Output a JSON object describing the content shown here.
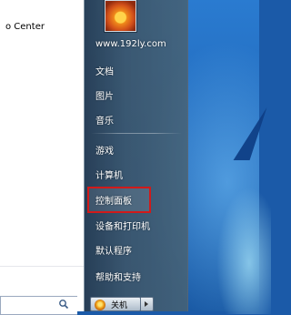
{
  "left_pane": {
    "items": [
      {
        "label": "o Center",
        "icon": "program-icon"
      }
    ],
    "search_placeholder": ""
  },
  "right_pane": {
    "items": [
      {
        "label": "www.192ly.com"
      },
      {
        "label": "文档"
      },
      {
        "label": "图片"
      },
      {
        "label": "音乐"
      },
      {
        "label": "游戏"
      },
      {
        "label": "计算机"
      },
      {
        "label": "控制面板"
      },
      {
        "label": "设备和打印机"
      },
      {
        "label": "默认程序"
      },
      {
        "label": "帮助和支持"
      }
    ],
    "shutdown_label": "关机"
  },
  "colors": {
    "highlight_border": "#d11a1a",
    "menu_bg": "#3d5468",
    "desktop_bg": "#1f65b7"
  }
}
